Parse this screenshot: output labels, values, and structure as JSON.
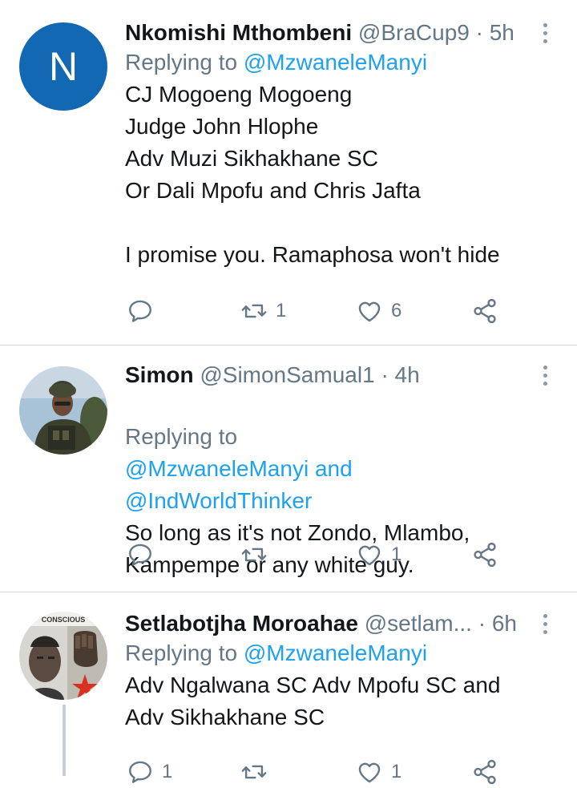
{
  "tweets": [
    {
      "avatar_letter": "N",
      "avatar_color": "#1368b4",
      "name": "Nkomishi Mthombeni",
      "handle": "@BraCup9",
      "separator": "·",
      "time": "5h",
      "replying_prefix": "Replying to",
      "replying_mentions": "@MzwaneleManyi",
      "text": "CJ Mogoeng Mogoeng\nJudge John Hlophe\nAdv Muzi Sikhakhane SC\nOr Dali Mpofu and Chris Jafta\n\nI promise you. Ramaphosa won't hide",
      "reply_icon": "reply-icon",
      "retweet_count": "1",
      "like_count": "6"
    },
    {
      "avatar_description": "soldier-photo-avatar",
      "name": "Simon",
      "handle": "@SimonSamual1",
      "separator": "·",
      "time": "4h",
      "replying_prefix": "Replying to",
      "replying_mentions": "@MzwaneleManyi and\n@IndWorldThinker",
      "text": "So long as it's not Zondo, Mlambo,\nKampempe or any white guy.",
      "retweet_count": "",
      "like_count": "1"
    },
    {
      "avatar_description": "conscious-fist-avatar",
      "avatar_text": "CONSCIOUS",
      "name": "Setlabotjha Moroahae",
      "handle": "@setlam...",
      "separator": "·",
      "time": "6h",
      "replying_prefix": "Replying to",
      "replying_mentions": "@MzwaneleManyi",
      "text": "Adv Ngalwana SC Adv Mpofu SC and\nAdv Sikhakhane SC",
      "reply_count": "1",
      "like_count": "1"
    }
  ],
  "colors": {
    "link": "#1da1f2",
    "secondary_text": "#657786",
    "divider": "#d7dbdf"
  }
}
